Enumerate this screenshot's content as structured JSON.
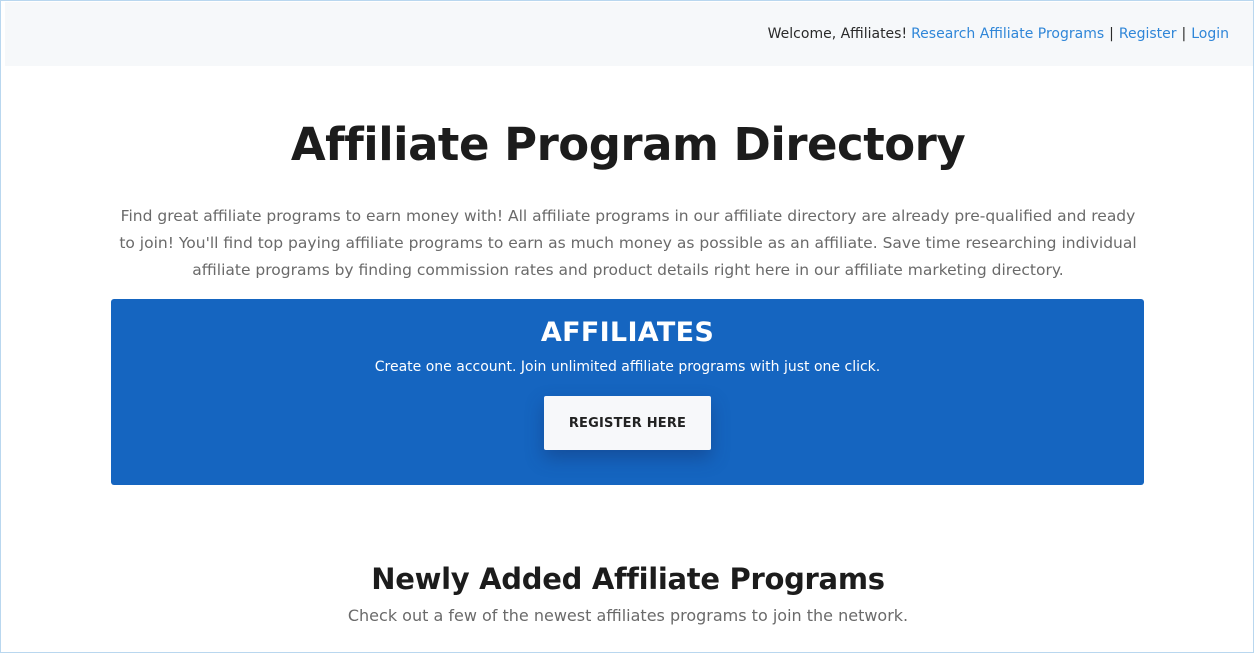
{
  "topbar": {
    "welcome": "Welcome, Affiliates!",
    "links": {
      "research": "Research Affiliate Programs",
      "register": "Register",
      "login": "Login"
    },
    "separator": "|"
  },
  "hero": {
    "title": "Affiliate Program Directory",
    "intro": "Find great affiliate programs to earn money with! All affiliate programs in our affiliate directory are already pre-qualified and ready to join! You'll find top paying affiliate programs to earn as much money as possible as an affiliate. Save time researching individual affiliate programs by finding commission rates and product details right here in our affiliate marketing directory."
  },
  "banner": {
    "title": "AFFILIATES",
    "subtitle": "Create one account. Join unlimited affiliate programs with just one click.",
    "button_label": "REGISTER HERE",
    "background_color": "#1565c0"
  },
  "newly_added": {
    "title": "Newly Added Affiliate Programs",
    "subtitle": "Check out a few of the newest affiliates programs to join the network."
  },
  "colors": {
    "link": "#2f86d8",
    "heading": "#1c1c1c",
    "body_text": "#6a6a6a"
  }
}
